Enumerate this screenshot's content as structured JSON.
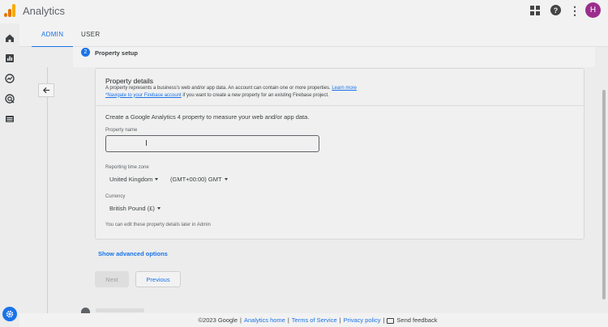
{
  "app": {
    "title": "Analytics",
    "avatar_letter": "H",
    "avatar_color": "#9c2d8c",
    "accent": "#1a73e8"
  },
  "header_icons": [
    "apps-grid-icon",
    "help-icon",
    "more-vert-icon"
  ],
  "nav_icons": [
    "home-icon",
    "reports-icon",
    "explore-icon",
    "advertising-icon",
    "configure-icon",
    "admin-gear-icon"
  ],
  "tabs": [
    {
      "label": "ADMIN",
      "active": true
    },
    {
      "label": "USER",
      "active": false
    }
  ],
  "step": {
    "number": "2",
    "title": "Property setup"
  },
  "card": {
    "title": "Property details",
    "desc_line1": "A property represents a business's web and/or app data. An account can contain one or more properties.",
    "learn_more": "Learn more",
    "firebase_link": "*Navigate to your Firebase account",
    "desc_line2": "if you want to create a new property for an existing Firebase project.",
    "create_text": "Create a Google Analytics 4 property to measure your web and/or app data.",
    "property_name_label": "Property name",
    "property_name_value": "",
    "timezone_label": "Reporting time zone",
    "timezone_country": "United Kingdom",
    "timezone_offset": "(GMT+00:00) GMT",
    "currency_label": "Currency",
    "currency_value": "British Pound (£)",
    "note": "You can edit these property details later in Admin"
  },
  "advanced_options": "Show advanced options",
  "buttons": {
    "next": "Next",
    "previous": "Previous"
  },
  "footer": {
    "copyright": "©2023 Google",
    "analytics_home": "Analytics home",
    "terms": "Terms of Service",
    "privacy": "Privacy policy",
    "feedback": "Send feedback"
  }
}
